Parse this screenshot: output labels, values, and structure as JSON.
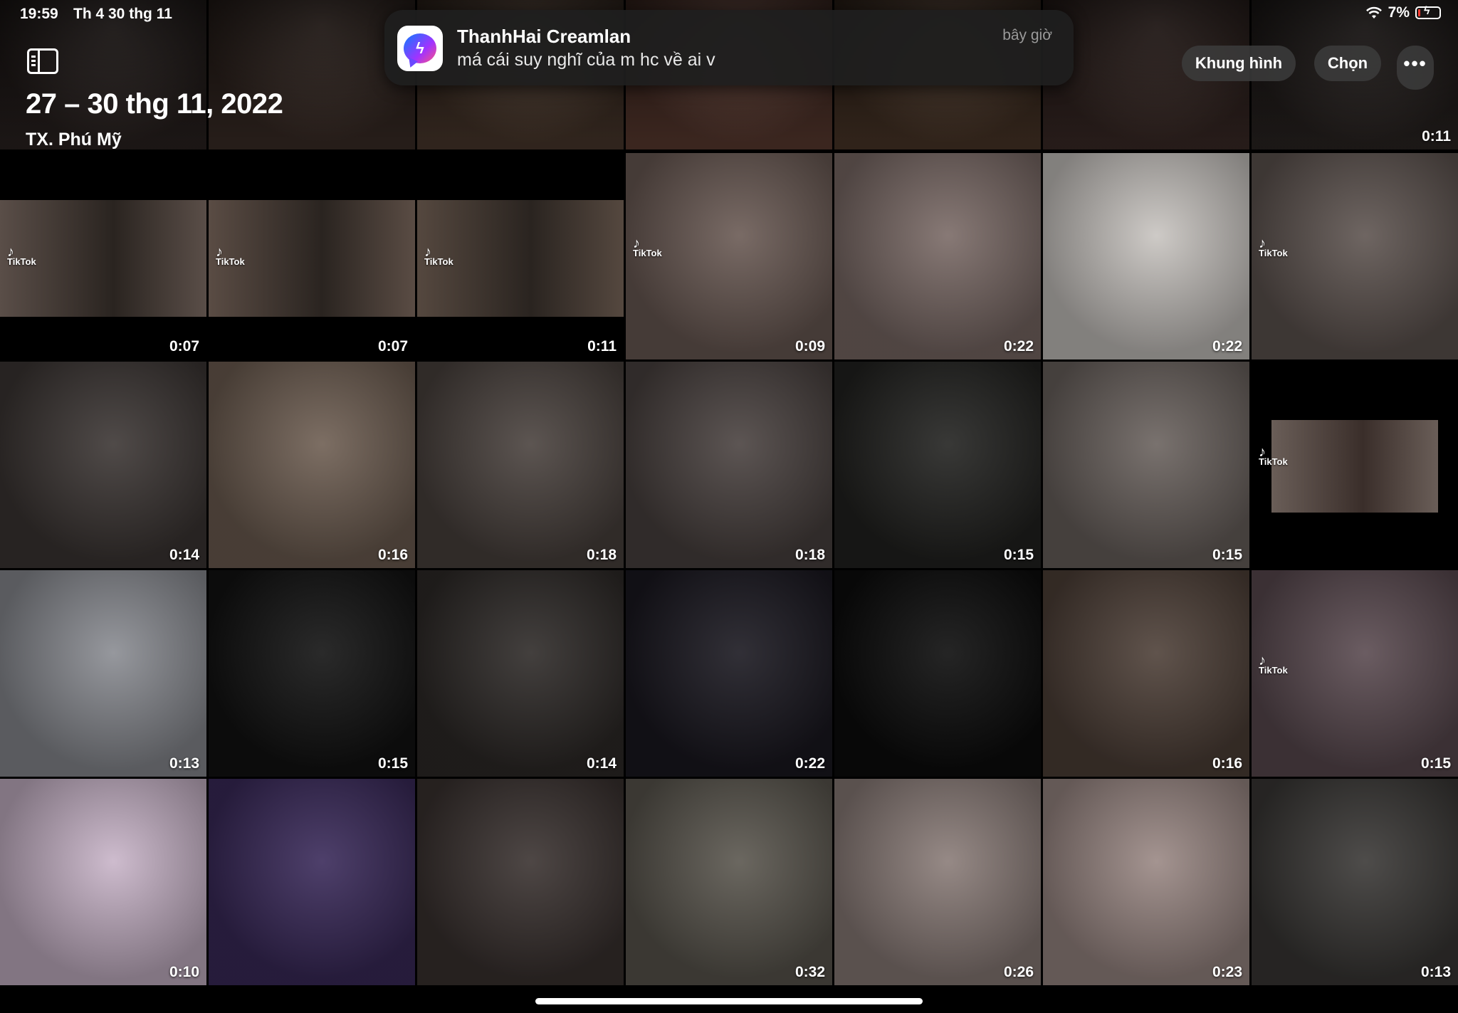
{
  "status_bar": {
    "time": "19:59",
    "date": "Th 4 30 thg 11",
    "battery": "7%"
  },
  "header": {
    "title": "27 – 30 thg 11, 2022",
    "location": "TX. Phú Mỹ"
  },
  "notification": {
    "sender": "ThanhHai Creamlan",
    "message": "má cái suy nghĩ của m hc về ai v",
    "time": "bây giờ",
    "app_icon": "messenger-icon"
  },
  "toolbar": {
    "aspect_label": "Khung hình",
    "select_label": "Chọn",
    "more_label": "•••"
  },
  "tiktok_label": "TikTok",
  "rows": [
    [
      {
        "dur": "",
        "bg": "#2a2220"
      },
      {
        "dur": "",
        "bg": "#3a2c26"
      },
      {
        "dur": "",
        "bg": "#4a382c"
      },
      {
        "dur": "",
        "bg": "#5a3a30"
      },
      {
        "dur": "",
        "bg": "#4a3628"
      },
      {
        "dur": "",
        "bg": "#3a2a26"
      },
      {
        "dur": "0:11",
        "bg": "#2a2422"
      }
    ],
    [
      {
        "dur": "0:07",
        "bg": "#5a4e48"
      },
      {
        "dur": "0:07",
        "bg": "#5a4c44"
      },
      {
        "dur": "0:11",
        "bg": "#55483f"
      },
      {
        "dur": "0:09",
        "bg": "#6a5a54"
      },
      {
        "dur": "0:22",
        "bg": "#7a6a66"
      },
      {
        "dur": "0:22",
        "bg": "#c8c4c0"
      },
      {
        "dur": "",
        "bg": "#5e5450"
      }
    ],
    [
      {
        "dur": "0:14",
        "bg": "#3c3634"
      },
      {
        "dur": "0:16",
        "bg": "#6e5e52"
      },
      {
        "dur": "0:18",
        "bg": "#4a423e"
      },
      {
        "dur": "0:18",
        "bg": "#4a4240"
      },
      {
        "dur": "0:15",
        "bg": "#222220"
      },
      {
        "dur": "0:15",
        "bg": "#6a625e"
      },
      {
        "dur": "",
        "bg": "#000000"
      }
    ],
    [
      {
        "dur": "0:13",
        "bg": "#8a8c92"
      },
      {
        "dur": "0:15",
        "bg": "#121212"
      },
      {
        "dur": "0:14",
        "bg": "#2e2a28"
      },
      {
        "dur": "0:22",
        "bg": "#1a1820"
      },
      {
        "dur": "",
        "bg": "#0c0c0c"
      },
      {
        "dur": "0:16",
        "bg": "#4e4038"
      },
      {
        "dur": "0:15",
        "bg": "#5a4a50"
      }
    ],
    [
      {
        "dur": "0:10",
        "bg": "#c8b4c8"
      },
      {
        "dur": "",
        "bg": "#3a2a5a"
      },
      {
        "dur": "",
        "bg": "#3a3230"
      },
      {
        "dur": "0:32",
        "bg": "#5a564e"
      },
      {
        "dur": "0:26",
        "bg": "#8a7c78"
      },
      {
        "dur": "0:23",
        "bg": "#9a8884"
      },
      {
        "dur": "0:13",
        "bg": "#3a3836"
      }
    ]
  ]
}
